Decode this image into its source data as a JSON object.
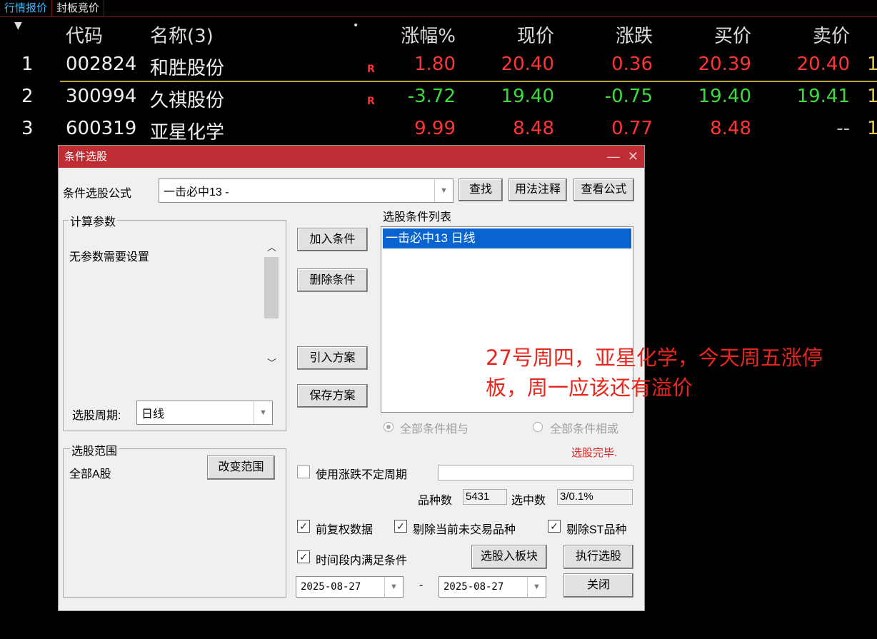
{
  "tabs": [
    "行情报价",
    "封板竞价"
  ],
  "table": {
    "headers": {
      "code": "代码",
      "name": "名称(3)",
      "pct": "涨幅%",
      "price": "现价",
      "chg": "涨跌",
      "bid": "买价",
      "ask": "卖价"
    },
    "rows": [
      {
        "idx": "1",
        "code": "002824",
        "name": "和胜股份",
        "flag": "R",
        "pct": "1.80",
        "price": "20.40",
        "chg": "0.36",
        "bid": "20.39",
        "ask": "20.40",
        "extra": "1"
      },
      {
        "idx": "2",
        "code": "300994",
        "name": "久祺股份",
        "flag": "R",
        "pct": "-3.72",
        "price": "19.40",
        "chg": "-0.75",
        "bid": "19.40",
        "ask": "19.41",
        "extra": "1"
      },
      {
        "idx": "3",
        "code": "600319",
        "name": "亚星化学",
        "flag": "",
        "pct": "9.99",
        "price": "8.48",
        "chg": "0.77",
        "bid": "8.48",
        "ask": "--",
        "extra": "1"
      }
    ]
  },
  "dialog": {
    "title": "条件选股",
    "formula_label": "条件选股公式",
    "formula_value": "一击必中13  -",
    "find_button": "查找",
    "usage_button": "用法注释",
    "view_formula_button": "查看公式",
    "params_group": "计算参数",
    "params_text": "无参数需要设置",
    "period_label": "选股周期:",
    "period_value": "日线",
    "range_group": "选股范围",
    "range_value": "全部A股",
    "change_range_button": "改变范围",
    "add_condition_button": "加入条件",
    "delete_condition_button": "删除条件",
    "import_plan_button": "引入方案",
    "save_plan_button": "保存方案",
    "condition_list_label": "选股条件列表",
    "condition_list_items": [
      "一击必中13  日线"
    ],
    "radio_and": "全部条件相与",
    "radio_or": "全部条件相或",
    "status": "选股完毕.",
    "use_variable_period": "使用涨跌不定周期",
    "count_label": "品种数",
    "count_value": "5431",
    "selected_label": "选中数",
    "selected_value": "3/0.1%",
    "chk_forward_adjust": "前复权数据",
    "chk_exclude_untraded": "剔除当前未交易品种",
    "chk_exclude_st": "剔除ST品种",
    "chk_time_range": "时间段内满足条件",
    "to_block_button": "选股入板块",
    "execute_button": "执行选股",
    "date_from": "2025-08-27",
    "date_sep": "-",
    "date_to": "2025-08-27",
    "close_button": "关闭"
  },
  "annotation": {
    "line1": "27号周四，亚星化学，今天周五涨停",
    "line2": "板，周一应该还有溢价"
  },
  "colors": {
    "up": "#ff3535",
    "down": "#3ddc3d",
    "title_bar": "#bf2d34",
    "selection": "#0a64d0",
    "annotation": "#e8261d"
  }
}
